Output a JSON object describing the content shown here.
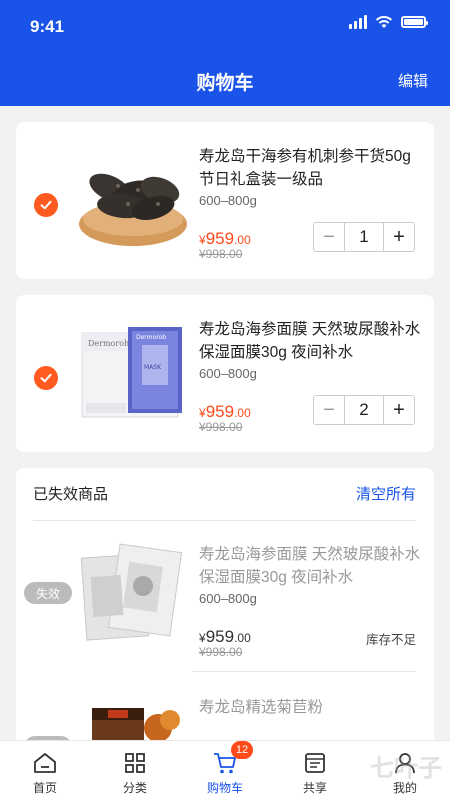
{
  "status": {
    "time": "9:41"
  },
  "header": {
    "title": "购物车",
    "edit": "编辑"
  },
  "items": [
    {
      "name": "寿龙岛干海参有机刺参干货50g节日礼盒装一级品",
      "spec": "600–800g",
      "currency": "¥",
      "price_int": "959",
      "price_dec": ".00",
      "original_price": "¥998.00",
      "qty": "1",
      "minus": "−",
      "plus": "+"
    },
    {
      "name": "寿龙岛海参面膜 天然玻尿酸补水保湿面膜30g 夜间补水",
      "spec": "600–800g",
      "currency": "¥",
      "price_int": "959",
      "price_dec": ".00",
      "original_price": "¥998.00",
      "qty": "2",
      "minus": "−",
      "plus": "+"
    }
  ],
  "invalid": {
    "title": "已失效商品",
    "clear": "清空所有",
    "tag": "失效",
    "items": [
      {
        "name": "寿龙岛海参面膜 天然玻尿酸补水保湿面膜30g 夜间补水",
        "spec": "600–800g",
        "currency": "¥",
        "price_int": "959",
        "price_dec": ".00",
        "original_price": "¥998.00",
        "stock": "库存不足"
      },
      {
        "name": "寿龙岛精选菊苣粉"
      }
    ]
  },
  "tabs": [
    {
      "label": "首页",
      "icon": "home-icon"
    },
    {
      "label": "分类",
      "icon": "grid-icon"
    },
    {
      "label": "购物车",
      "icon": "cart-icon",
      "badge": "12"
    },
    {
      "label": "共享",
      "icon": "share-icon"
    },
    {
      "label": "我的",
      "icon": "user-icon"
    }
  ],
  "colors": {
    "primary": "#1a53e8",
    "accent": "#ff4a1a",
    "check": "#ff5a1f"
  },
  "watermark": "七叶子"
}
